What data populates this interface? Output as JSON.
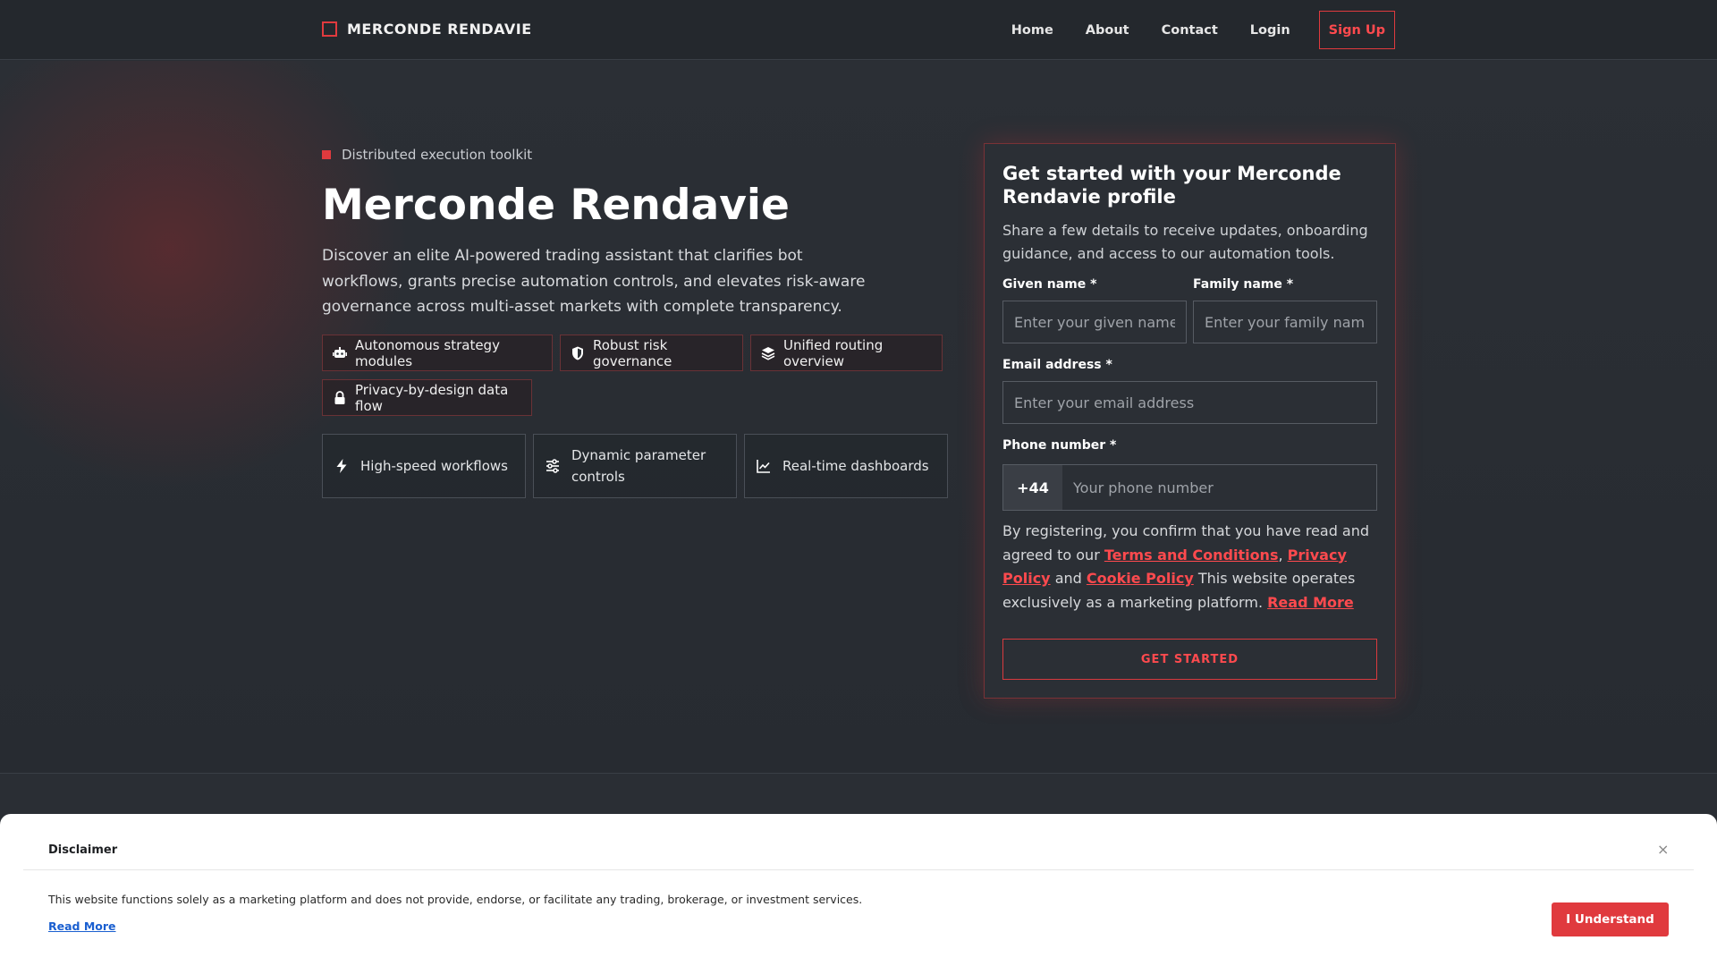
{
  "header": {
    "brand": "MERCONDE RENDAVIE",
    "nav": [
      "Home",
      "About",
      "Contact",
      "Login"
    ],
    "signup_label": "Sign Up"
  },
  "hero": {
    "eyebrow": "Distributed execution toolkit",
    "title": "Merconde Rendavie",
    "description": "Discover an elite AI-powered trading assistant that clarifies bot workflows, grants precise automation controls, and elevates risk-aware governance across multi-asset markets with complete transparency.",
    "chips": [
      {
        "icon": "robot-icon",
        "label": "Autonomous strategy modules"
      },
      {
        "icon": "shield-icon",
        "label": "Robust risk governance"
      },
      {
        "icon": "layers-icon",
        "label": "Unified routing overview"
      },
      {
        "icon": "lock-icon",
        "label": "Privacy-by-design data flow"
      }
    ],
    "features": [
      {
        "icon": "bolt-icon",
        "label": "High-speed workflows"
      },
      {
        "icon": "sliders-icon",
        "label": "Dynamic parameter controls"
      },
      {
        "icon": "line-chart-icon",
        "label": "Real-time dashboards"
      }
    ]
  },
  "form": {
    "title": "Get started with your Merconde Rendavie profile",
    "subtitle": "Share a few details to receive updates, onboarding guidance, and access to our automation tools.",
    "given_name_label": "Given name *",
    "given_name_placeholder": "Enter your given name",
    "family_name_label": "Family name *",
    "family_name_placeholder": "Enter your family name",
    "email_label": "Email address *",
    "email_placeholder": "Enter your email address",
    "phone_label": "Phone number *",
    "phone_code": "+44",
    "phone_placeholder": "Your phone number",
    "legal_prefix": "By registering, you confirm that you have read and agreed to our ",
    "terms_link": "Terms and Conditions",
    "legal_comma": ", ",
    "privacy_link": "Privacy Policy",
    "legal_and": " and ",
    "cookie_link": "Cookie Policy",
    "legal_suffix": " This website operates exclusively as a marketing platform. ",
    "read_more_link": "Read More",
    "submit_label": "GET STARTED"
  },
  "disclaimer": {
    "title": "Disclaimer",
    "close_glyph": "×",
    "text": "This website functions solely as a marketing platform and does not provide, endorse, or facilitate any trading, brokerage, or investment services.",
    "read_more": "Read More",
    "accept_label": "I Understand"
  },
  "colors": {
    "accent": "#e03a3e",
    "background": "#2a2e34",
    "link": "#1a5fd0"
  }
}
